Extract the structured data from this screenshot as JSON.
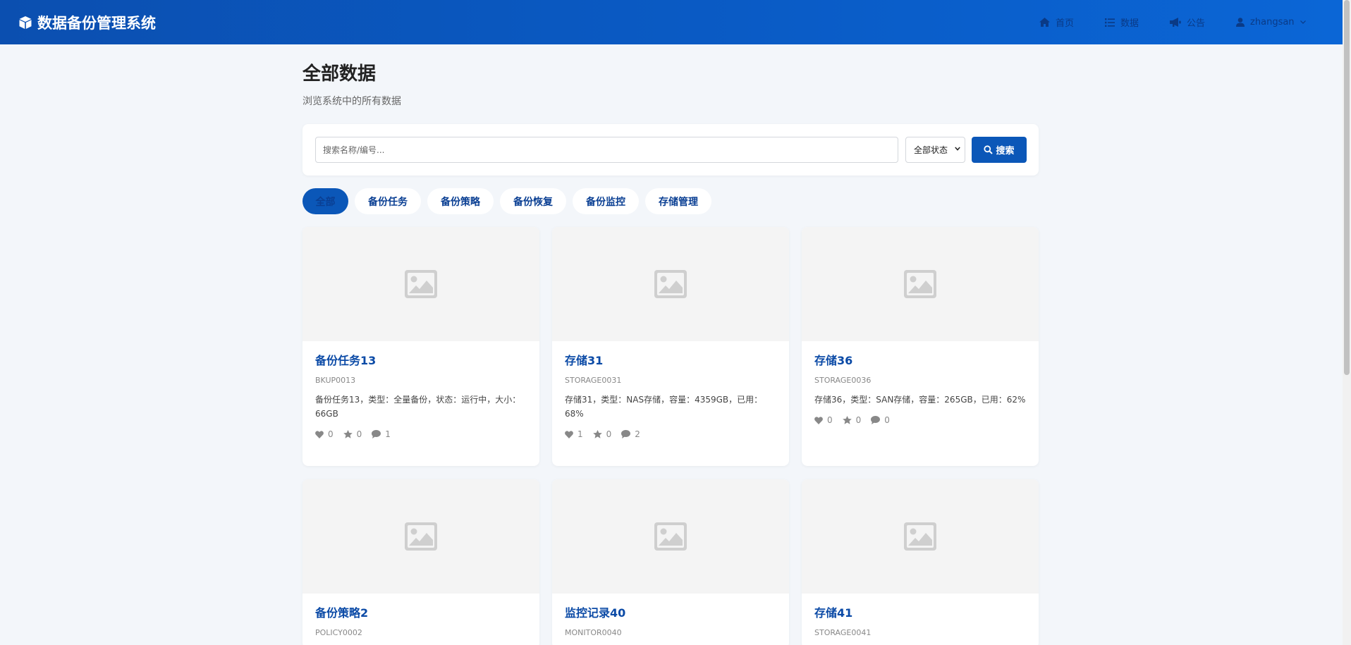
{
  "app": {
    "title": "数据备份管理系统"
  },
  "nav": {
    "home": "首页",
    "data": "数据",
    "notice": "公告",
    "user": "zhangsan"
  },
  "page": {
    "title": "全部数据",
    "subtitle": "浏览系统中的所有数据"
  },
  "search": {
    "placeholder": "搜索名称/编号...",
    "status_selected": "全部状态",
    "button": "搜索"
  },
  "tabs": [
    {
      "label": "全部",
      "active": true
    },
    {
      "label": "备份任务"
    },
    {
      "label": "备份策略"
    },
    {
      "label": "备份恢复"
    },
    {
      "label": "备份监控"
    },
    {
      "label": "存储管理"
    }
  ],
  "cards": [
    {
      "title": "备份任务13",
      "code": "BKUP0013",
      "desc": "备份任务13，类型：全量备份，状态：运行中，大小：66GB",
      "likes": "0",
      "stars": "0",
      "comments": "1"
    },
    {
      "title": "存储31",
      "code": "STORAGE0031",
      "desc": "存储31，类型：NAS存储，容量：4359GB，已用：68%",
      "likes": "1",
      "stars": "0",
      "comments": "2"
    },
    {
      "title": "存储36",
      "code": "STORAGE0036",
      "desc": "存储36，类型：SAN存储，容量：265GB，已用：62%",
      "likes": "0",
      "stars": "0",
      "comments": "0"
    },
    {
      "title": "备份策略2",
      "code": "POLICY0002"
    },
    {
      "title": "监控记录40",
      "code": "MONITOR0040"
    },
    {
      "title": "存储41",
      "code": "STORAGE0041"
    }
  ],
  "colors": {
    "primary": "#0b57b8",
    "navbar": "#0a5cc7",
    "title_link": "#0b4aa6",
    "background": "#f3f6fa"
  }
}
